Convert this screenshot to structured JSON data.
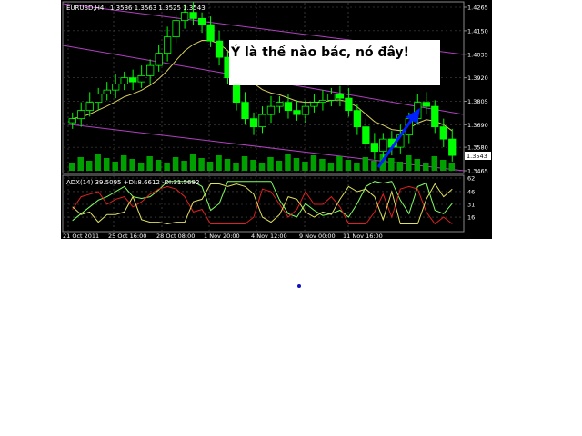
{
  "chart_header": {
    "symbol": "EURUSD,H4",
    "values": "1.3536 1.3563 1.3525 1.3543"
  },
  "annotation_text": "Ý là thế nào bác, nó đây!",
  "current_price_label": "1.3543",
  "indicator_header": "ADX(14) 39.5095 +DI:8.6612 -DI:31.5692",
  "colors": {
    "background": "#000000",
    "candles": "#00ff00",
    "moving_average": "#d8d060",
    "channel_lines": "#b040c0",
    "volume": "#00a000",
    "adx_line": "#80ff60",
    "plus_di": "#e02020",
    "minus_di": "#e0e060",
    "arrow": "#0020ff",
    "grid": "#888888"
  },
  "chart_data": {
    "type": "candlestick",
    "title": "EURUSD,H4",
    "price_axis_ticks": [
      "1.4265",
      "1.4150",
      "1.4035",
      "1.3920",
      "1.3805",
      "1.3690",
      "1.3580",
      "1.3465"
    ],
    "time_axis_ticks": [
      "21 Oct 2011",
      "25 Oct 16:00",
      "28 Oct 08:00",
      "1 Nov 20:00",
      "4 Nov 12:00",
      "9 Nov 00:00",
      "11 Nov 16:00"
    ],
    "indicator_axis_ticks": [
      "62",
      "46",
      "31",
      "16"
    ],
    "ylim": [
      1.3465,
      1.4265
    ],
    "indicator_ylim": [
      0,
      62
    ],
    "series": [
      {
        "name": "EURUSD,H4",
        "closes_approx": [
          1.372,
          1.376,
          1.38,
          1.384,
          1.386,
          1.389,
          1.392,
          1.39,
          1.393,
          1.398,
          1.404,
          1.412,
          1.42,
          1.424,
          1.421,
          1.418,
          1.41,
          1.402,
          1.392,
          1.38,
          1.372,
          1.368,
          1.374,
          1.378,
          1.38,
          1.376,
          1.374,
          1.378,
          1.38,
          1.381,
          1.384,
          1.382,
          1.376,
          1.368,
          1.36,
          1.356,
          1.362,
          1.358,
          1.364,
          1.372,
          1.38,
          1.378,
          1.368,
          1.362,
          1.354
        ]
      }
    ],
    "last_value": 1.3543
  }
}
